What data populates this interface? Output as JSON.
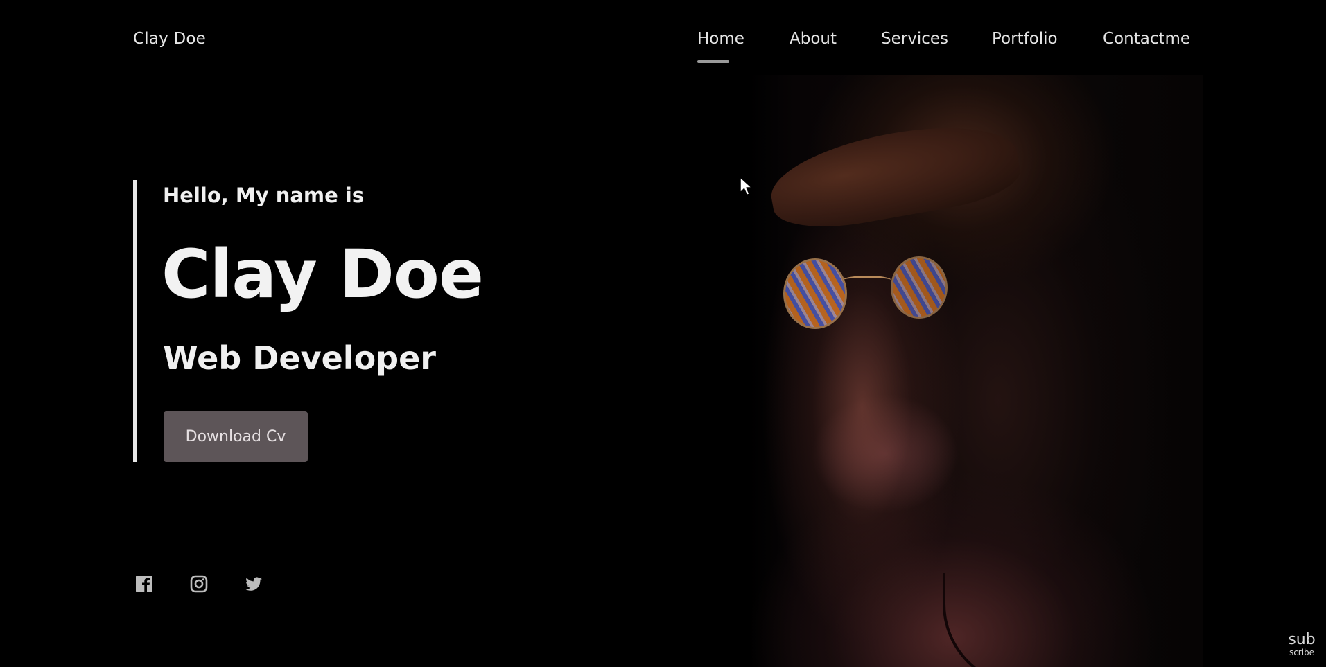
{
  "header": {
    "logo": "Clay Doe",
    "nav": [
      {
        "label": "Home",
        "active": true
      },
      {
        "label": "About",
        "active": false
      },
      {
        "label": "Services",
        "active": false
      },
      {
        "label": "Portfolio",
        "active": false
      },
      {
        "label": "Contactme",
        "active": false
      }
    ]
  },
  "hero": {
    "greeting": "Hello, My name is",
    "name": "Clay Doe",
    "role": "Web Developer",
    "cta_label": "Download Cv",
    "portrait_alt": "portrait"
  },
  "social": [
    {
      "icon": "facebook-icon"
    },
    {
      "icon": "instagram-icon"
    },
    {
      "icon": "twitter-icon"
    }
  ],
  "watermark": {
    "line1": "sub",
    "line2": "scribe"
  },
  "colors": {
    "background": "#000000",
    "text": "#f0f0f0",
    "button_bg": "#5d5558",
    "nav_underline": "#9a9a9a"
  }
}
